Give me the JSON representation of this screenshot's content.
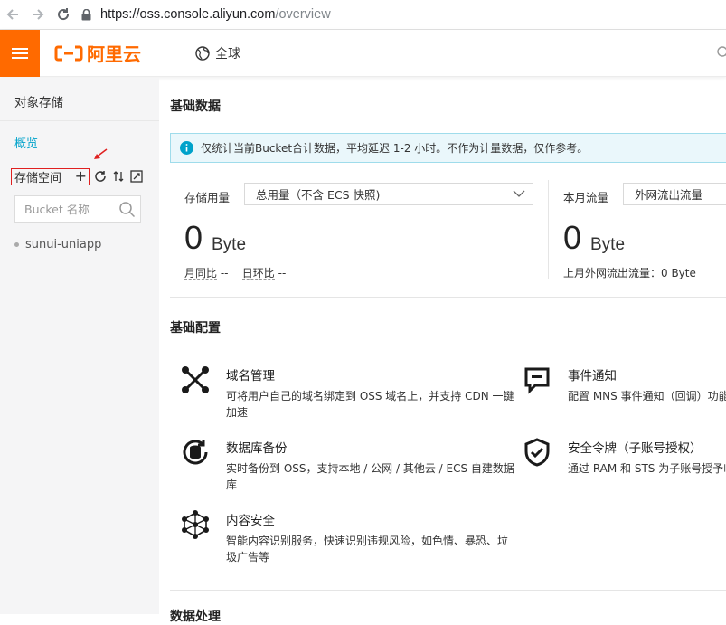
{
  "browser": {
    "url_host": "https://oss.console.aliyun.com",
    "url_path": "/overview"
  },
  "topbar": {
    "logo_text": "阿里云",
    "region_label": "全球"
  },
  "sidebar": {
    "title": "对象存储",
    "overview": "概览",
    "buckets_label": "存储空间",
    "search_placeholder": "Bucket 名称",
    "bucket_items": [
      "sunui-uniapp"
    ]
  },
  "main": {
    "basic_data_title": "基础数据",
    "notice_text": "仅统计当前Bucket合计数据，平均延迟 1-2 小时。不作为计量数据，仅作参考。",
    "storage": {
      "label": "存储用量",
      "select_value": "总用量（不含 ECS 快照)",
      "value": "0",
      "unit": "Byte",
      "yoy_label": "月同比",
      "yoy_value": "--",
      "mom_label": "日环比",
      "mom_value": "--"
    },
    "traffic": {
      "label": "本月流量",
      "select_value": "外网流出流量",
      "value": "0",
      "unit": "Byte",
      "last_month_text": "上月外网流出流量：0 Byte"
    },
    "basic_config_title": "基础配置",
    "features": [
      {
        "name": "域名管理",
        "desc": "可将用户自己的域名绑定到 OSS 域名上，并支持 CDN 一键加速"
      },
      {
        "name": "事件通知",
        "desc": "配置 MNS 事件通知（回调）功能，"
      },
      {
        "name": "数据库备份",
        "desc": "实时备份到 OSS，支持本地 / 公网 / 其他云 / ECS 自建数据库"
      },
      {
        "name": "安全令牌（子账号授权）",
        "desc": "通过 RAM 和 STS 为子账号授予临时"
      },
      {
        "name": "内容安全",
        "desc": "智能内容识别服务，快速识别违规风险，如色情、暴恐、垃圾广告等"
      }
    ],
    "next_section_title": "数据处理"
  },
  "colors": {
    "brand_orange": "#ff6a00",
    "link_blue": "#00a2ca",
    "notice_bg": "#eaf7fb",
    "highlight_red": "#e02020"
  }
}
